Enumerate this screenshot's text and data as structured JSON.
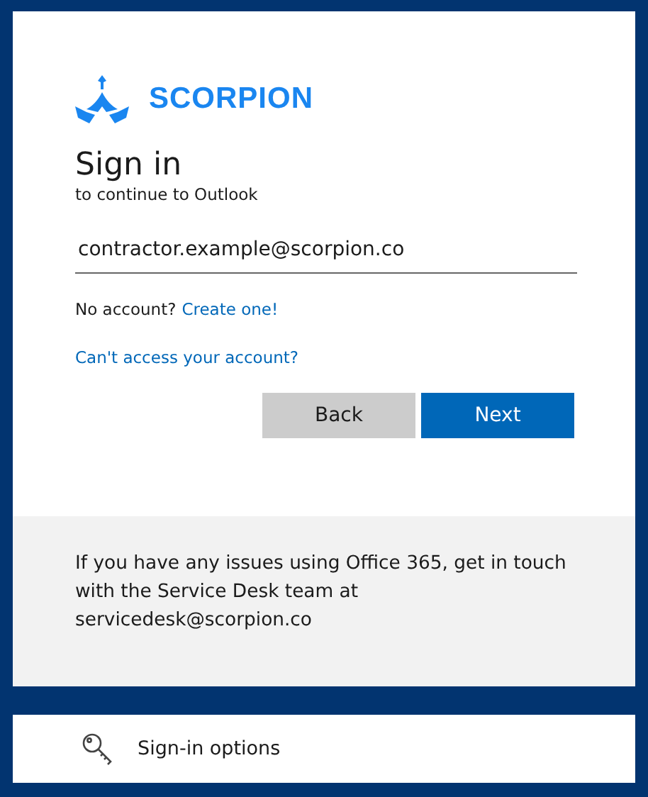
{
  "logo": {
    "text": "SCORPION"
  },
  "title": "Sign in",
  "subtitle": "to continue to Outlook",
  "email_field": {
    "value": "contractor.example@scorpion.co"
  },
  "no_account": {
    "text": "No account?",
    "link": "Create one!"
  },
  "cant_access_link": "Can't access your account?",
  "buttons": [
    {
      "label": "Back",
      "kind": "secondary"
    },
    {
      "label": "Next",
      "kind": "primary"
    }
  ],
  "notice": "If you have any issues using Office 365, get in touch with the Service Desk team at servicedesk@scorpion.co",
  "sign_in_options": {
    "label": "Sign-in options"
  }
}
